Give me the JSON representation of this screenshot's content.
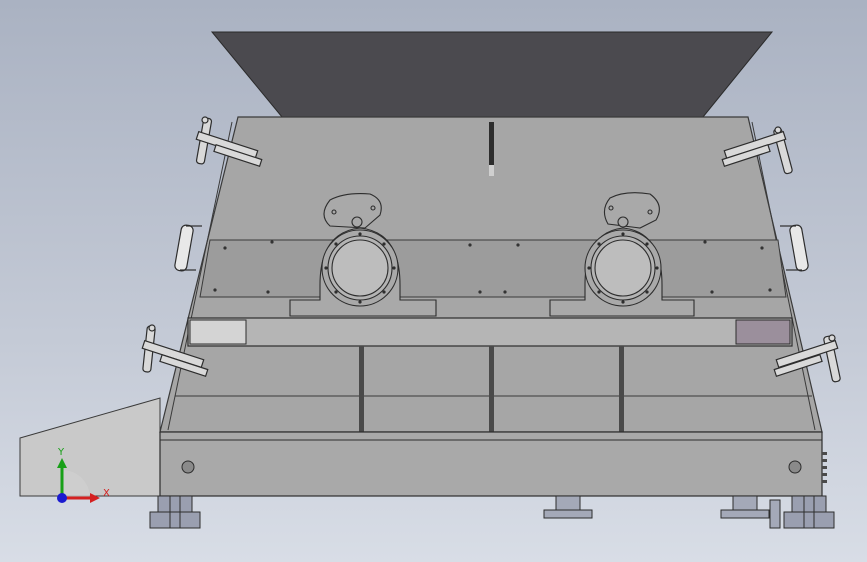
{
  "viewport": {
    "type": "cad-3d-viewport",
    "view": "front",
    "background_top": "#aab2c2",
    "background_bottom": "#d8dde6"
  },
  "triad": {
    "x_label": "X",
    "y_label": "Y",
    "x_color": "#d42020",
    "y_color": "#18a018",
    "z_color": "#1a1ad0"
  },
  "model": {
    "hopper_color": "#4b4a4f",
    "body_color": "#a6a6a6",
    "line_color": "#3a3a3a",
    "left_panel_color": "#d4d4d4",
    "right_panel_color": "#9b8f9c"
  }
}
